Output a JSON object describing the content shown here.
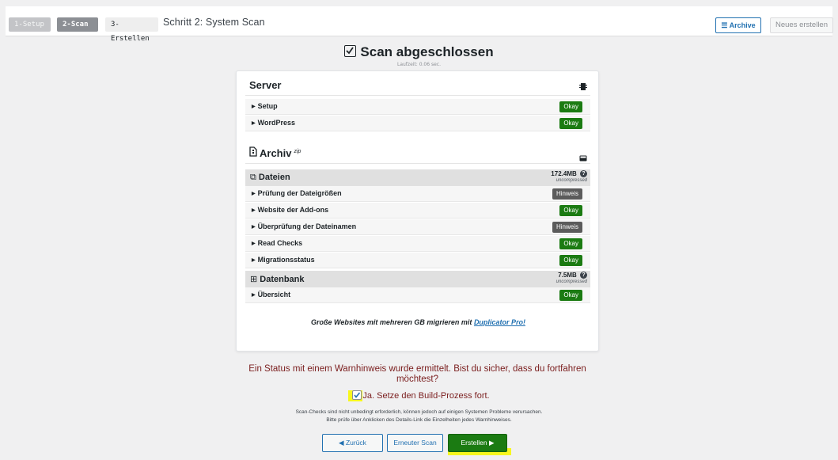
{
  "header": {
    "steps": [
      "1-Setup",
      "2-Scan",
      "3-Erstellen"
    ],
    "title": "Schritt 2: System Scan",
    "archive_label": "Archive",
    "new_label": "Neues erstellen"
  },
  "scan": {
    "title": "Scan abgeschlossen",
    "runtime": "Laufzeit: 0.06 sec."
  },
  "server": {
    "title": "Server",
    "rows": [
      {
        "label": "Setup",
        "status": "Okay"
      },
      {
        "label": "WordPress",
        "status": "Okay"
      }
    ]
  },
  "archive": {
    "title": "Archiv",
    "suffix": "zip",
    "files": {
      "label": "Dateien",
      "size": "172.4MB",
      "size_note": "uncompressed",
      "rows": [
        {
          "label": "Prüfung der Dateigrößen",
          "status": "Hinweis"
        },
        {
          "label": "Website der Add-ons",
          "status": "Okay"
        },
        {
          "label": "Überprüfung der Dateinamen",
          "status": "Hinweis"
        },
        {
          "label": "Read Checks",
          "status": "Okay"
        },
        {
          "label": "Migrationsstatus",
          "status": "Okay"
        }
      ]
    },
    "database": {
      "label": "Datenbank",
      "size": "7.5MB",
      "size_note": "uncompressed",
      "rows": [
        {
          "label": "Übersicht",
          "status": "Okay"
        }
      ]
    }
  },
  "promo": {
    "text": "Große Websites mit mehreren GB migrieren mit",
    "link": "Duplicator Pro!"
  },
  "warning": {
    "message": "Ein Status mit einem Warnhinweis wurde ermittelt. Bist du sicher, dass du fortfahren möchtest?",
    "confirm_label": "Ja. Setze den Build-Prozess fort.",
    "note_line1": "Scan-Checks sind nicht unbedingt erforderlich, können jedoch auf einigen Systemen Probleme verursachen.",
    "note_line2": "Bitte prüfe über Anklicken des Details-Link die Einzelheiten jedes Warnhinweises."
  },
  "actions": {
    "back": "◀ Zurück",
    "rescan": "Erneuter Scan",
    "build": "Erstellen ▶"
  },
  "colors": {
    "ok": "#1b7b12",
    "warn": "#5b5b5b",
    "accent": "#2271b1",
    "alert": "#7a1d1d",
    "highlight": "#f7f71e"
  }
}
